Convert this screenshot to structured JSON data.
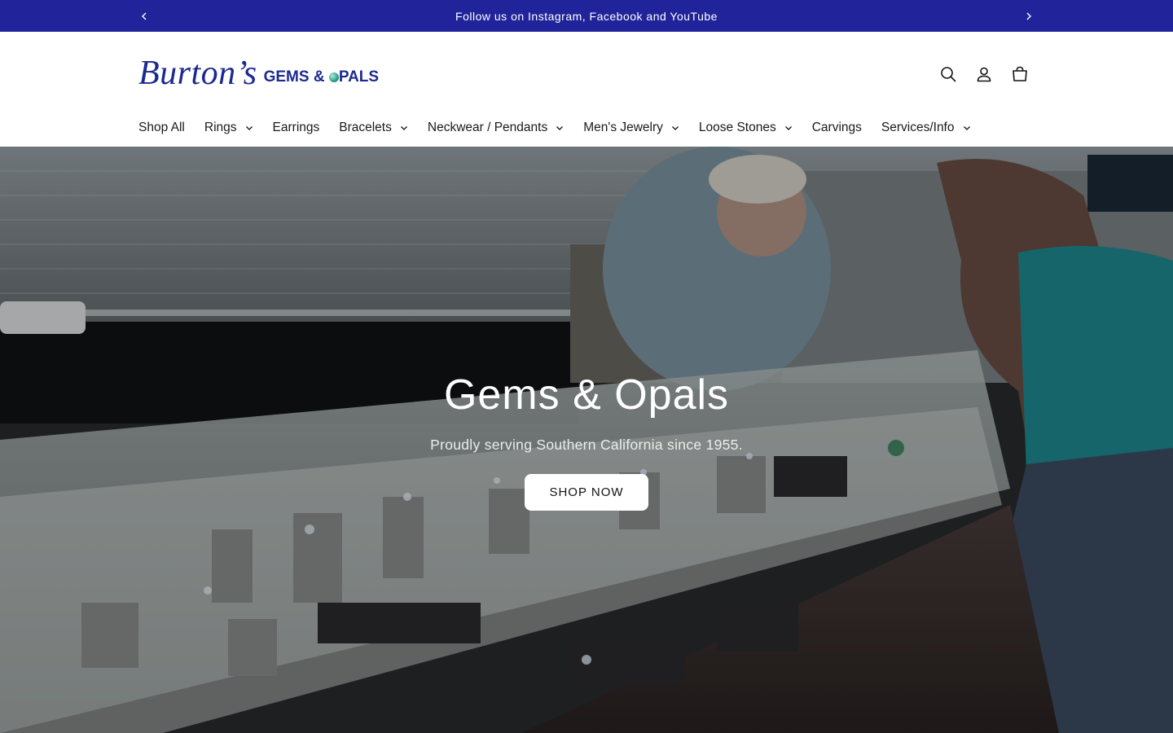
{
  "announcement": {
    "text": "Follow us on Instagram, Facebook and YouTube",
    "prev_icon": "chevron-left-icon",
    "next_icon": "chevron-right-icon"
  },
  "header": {
    "logo_script": "Burton’s",
    "logo_sub_before": "GEMS & ",
    "logo_sub_after": "PALS",
    "icons": [
      "search-icon",
      "account-icon",
      "cart-icon"
    ]
  },
  "nav": {
    "items": [
      {
        "label": "Shop All",
        "dropdown": false
      },
      {
        "label": "Rings",
        "dropdown": true
      },
      {
        "label": "Earrings",
        "dropdown": false
      },
      {
        "label": "Bracelets",
        "dropdown": true
      },
      {
        "label": "Neckwear / Pendants",
        "dropdown": true
      },
      {
        "label": "Men's Jewelry",
        "dropdown": true
      },
      {
        "label": "Loose Stones",
        "dropdown": true
      },
      {
        "label": "Carvings",
        "dropdown": false
      },
      {
        "label": "Services/Info",
        "dropdown": true
      }
    ]
  },
  "hero": {
    "title": "Gems & Opals",
    "subtitle": "Proudly serving Southern California since 1955.",
    "button_label": "SHOP NOW"
  },
  "colors": {
    "announcement_bg": "#20239a",
    "brand_blue": "#1c2a8f",
    "hero_button_bg": "#ffffff"
  }
}
